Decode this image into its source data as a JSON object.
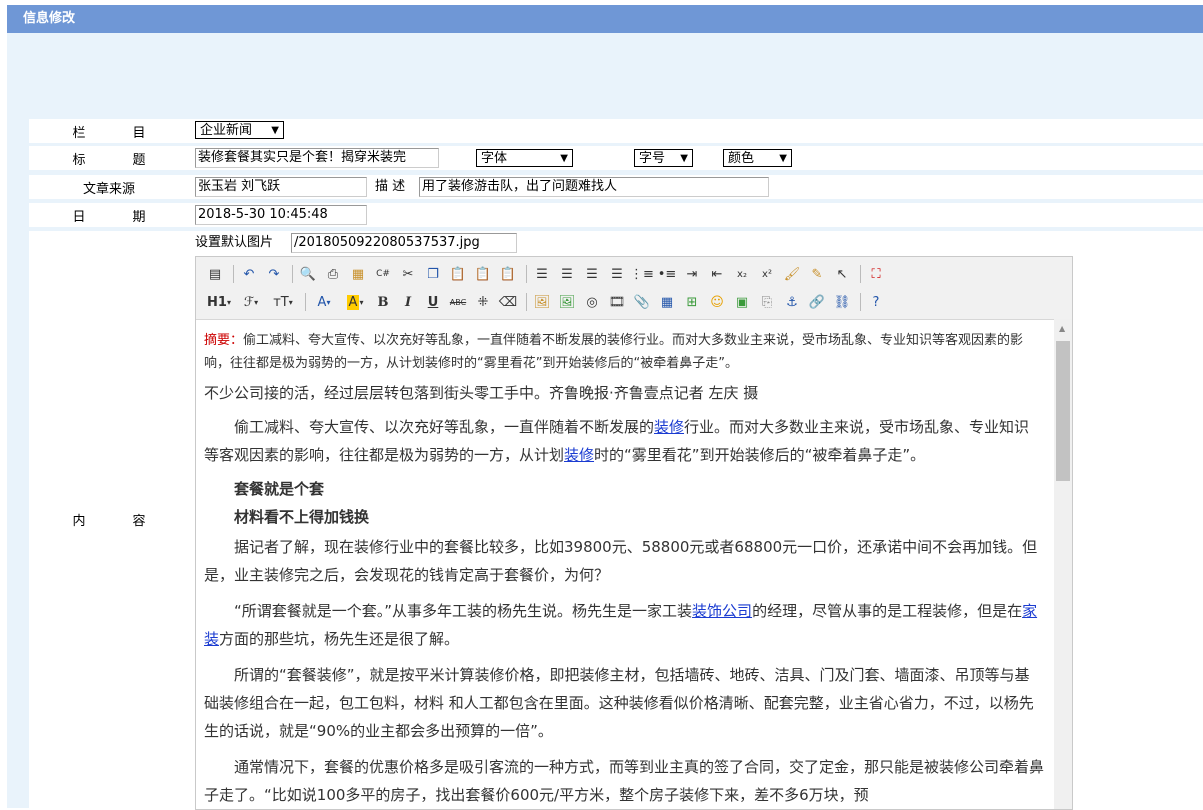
{
  "page": {
    "title": "信息修改"
  },
  "form": {
    "column": {
      "label_a": "栏",
      "label_b": "目",
      "value": "企业新闻"
    },
    "title": {
      "label_a": "标",
      "label_b": "题",
      "value": "装修套餐其实只是个套！揭穿米装完",
      "font_select": "字体",
      "size_select": "字号",
      "color_select": "颜色"
    },
    "source": {
      "label": "文章来源",
      "value": "张玉岩 刘飞跃",
      "desc_label": "描 述",
      "desc_value": "用了装修游击队，出了问题难找人"
    },
    "date": {
      "label_a": "日",
      "label_b": "期",
      "value": "2018-5-30 10:45:48"
    },
    "image": {
      "label": "设置默认图片",
      "value": "/201805092208053­7537.jpg"
    },
    "content": {
      "label_a": "内",
      "label_b": "容"
    }
  },
  "toolbar": {
    "row1": [
      "source-icon",
      "undo-icon",
      "redo-icon",
      "preview-icon",
      "print-icon",
      "template-icon",
      "code-icon",
      "cut-icon",
      "copy-icon",
      "paste-icon",
      "paste-text-icon",
      "paste-word-icon",
      "align-left-icon",
      "align-center-icon",
      "align-right-icon",
      "justify-icon",
      "ordered-list-icon",
      "unordered-list-icon",
      "indent-icon",
      "outdent-icon",
      "subscript-icon",
      "superscript-icon",
      "format-brush-icon",
      "clear-format-icon",
      "select-all-icon",
      "fullscreen-icon"
    ],
    "h1": "H1",
    "font_icon": "ℱ",
    "size_icon": "тT",
    "bold": "B",
    "italic": "I",
    "underline": "U",
    "strike": "ABC",
    "hr": "⁜",
    "eraser": "⌫",
    "color_a": "A",
    "color_bg": "A"
  },
  "doc": {
    "summary_label": "摘要：",
    "summary_text": "偷工减料、夸大宣传、以次充好等乱象，一直伴随着不断发展的装修行业。而对大多数业主来说，受市场乱象、专业知识等客观因素的影响，往往都是极为弱势的一方，从计划装修时的“雾里看花”到开始装修后的“被牵着鼻子走”。",
    "byline": "不少公司接的活，经过层层转包落到街头零工手中。齐鲁晚报·齐鲁壹点记者 左庆 摄",
    "p1_a": "偷工减料、夸大宣传、以次充好等乱象，一直伴随着不断发展的",
    "p1_link1": "装修",
    "p1_b": "行业。而对大多数业主来说，受市场乱象、专业知识等客观因素的影响，往往都是极为弱势的一方，从计划",
    "p1_link2": "装修",
    "p1_c": "时的“雾里看花”到开始装修后的“被牵着鼻子走”。",
    "h_a": "套餐就是个套",
    "h_b": "材料看不上得加钱换",
    "p2": "据记者了解，现在装修行业中的套餐比较多，比如39800元、58800元或者68800元一口价，还承诺中间不会再加钱。但是，业主装修完之后，会发现花的钱肯定高于套餐价，为何？",
    "p3_a": "“所谓套餐就是一个套。”从事多年工装的杨先生说。杨先生是一家工装",
    "p3_link1": "装饰公司",
    "p3_b": "的经理，尽管从事的是工程装修，但是在",
    "p3_link2": "家装",
    "p3_c": "方面的那些坑，杨先生还是很了解。",
    "p4": "所谓的“套餐装修”，就是按平米计算装修价格，即把装修主材，包括墙砖、地砖、洁具、门及门套、墙面漆、吊顶等与基础装修组合在一起，包工包料，材料 和人工都包含在里面。这种装修看似价格清晰、配套完整，业主省心省力，不过，以杨先生的话说，就是“90%的业主都会多出预算的一倍”。",
    "p5": "通常情况下，套餐的优惠价格多是吸引客流的一种方式，而等到业主真的签了合同，交了定金，那只能是被装修公司牵着鼻子走了。“比如说100多平的房子，找出套餐价600元/平方米，整个房子装修下来，差不多6万块，预"
  },
  "colors": {
    "titlebar": "#6f97d6",
    "panel": "#e9f3fb",
    "link": "#1a3bd1",
    "summary_label": "#c00000"
  }
}
